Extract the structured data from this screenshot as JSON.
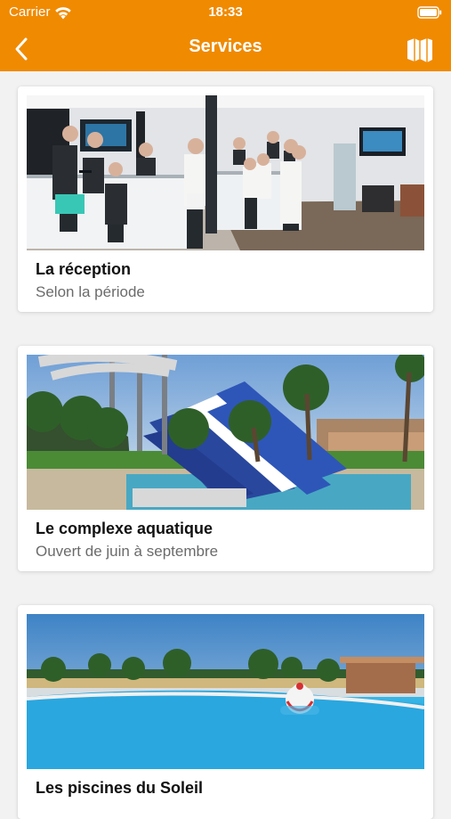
{
  "status_bar": {
    "carrier": "Carrier",
    "time": "18:33"
  },
  "header": {
    "title": "Services",
    "back_icon": "chevron-left-icon",
    "map_icon": "map-icon",
    "background_color": "#f08a00"
  },
  "services": [
    {
      "title": "La réception",
      "subtitle": "Selon la période"
    },
    {
      "title": "Le complexe aquatique",
      "subtitle": "Ouvert de juin à septembre"
    },
    {
      "title": "Les piscines du Soleil",
      "subtitle": ""
    }
  ]
}
